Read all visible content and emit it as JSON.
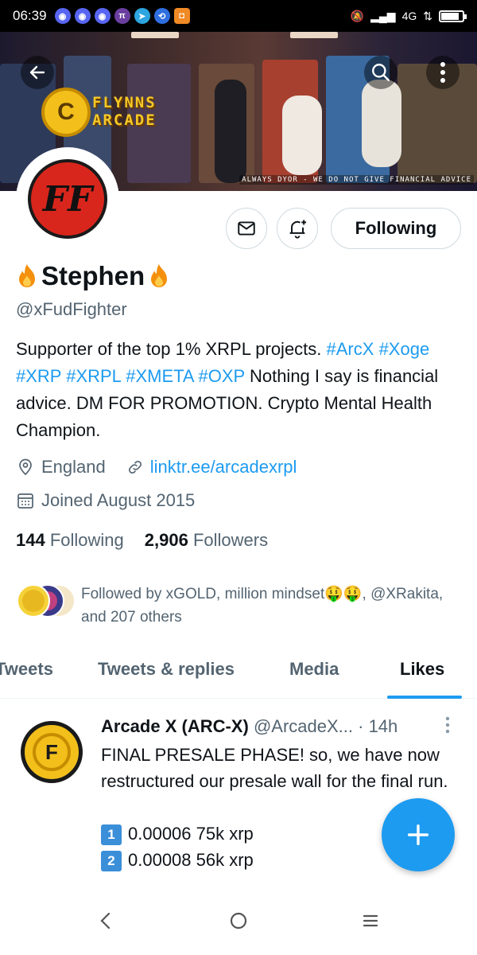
{
  "status_bar": {
    "time": "06:39",
    "network": "4G",
    "notification_icons": [
      "discord-icon",
      "discord-icon",
      "discord-icon",
      "pi-network-icon",
      "telegram-icon",
      "share-icon",
      "app-icon"
    ],
    "battery_level": 0.8
  },
  "banner": {
    "logo_line1": "FLYNNS",
    "logo_line2": "ARCADE",
    "disclaimer": "ALWAYS DYOR - WE DO NOT GIVE FINANCIAL ADVICE"
  },
  "profile": {
    "name": "Stephen",
    "handle": "@xFudFighter",
    "follow_button": "Following",
    "bio_parts": {
      "p1": "Supporter of the top 1% XRPL projects. ",
      "t1": "#ArcX",
      "t2": "#Xoge",
      "t3": "#XRP",
      "t4": "#XRPL",
      "t5": "#XMETA",
      "t6": "#OXP",
      "p2": " Nothing I say is financial advice. DM FOR PROMOTION. Crypto Mental Health Champion."
    },
    "location": "England",
    "link": "linktr.ee/arcadexrpl",
    "joined": "Joined August 2015",
    "following_count": "144",
    "following_label": "Following",
    "followers_count": "2,906",
    "followers_label": "Followers",
    "followed_by": "Followed by xGOLD, million mindset🤑🤑, @XRakita, and 207 others"
  },
  "tabs": [
    {
      "label": "Tweets"
    },
    {
      "label": "Tweets & replies"
    },
    {
      "label": "Media"
    },
    {
      "label": "Likes"
    }
  ],
  "tweet": {
    "author": "Arcade X (ARC-X)",
    "handle": "@ArcadeX...",
    "time": "· 14h",
    "text_line1": "FINAL PRESALE PHASE! so, we have now restructured our presale wall for the final run.",
    "item1_num": "1",
    "item1_text": "0.00006 75k xrp",
    "item2_num": "2",
    "item2_text": "0.00008 56k xrp"
  },
  "colors": {
    "accent": "#1d9bf0",
    "text": "#0f1419",
    "muted": "#536471"
  }
}
